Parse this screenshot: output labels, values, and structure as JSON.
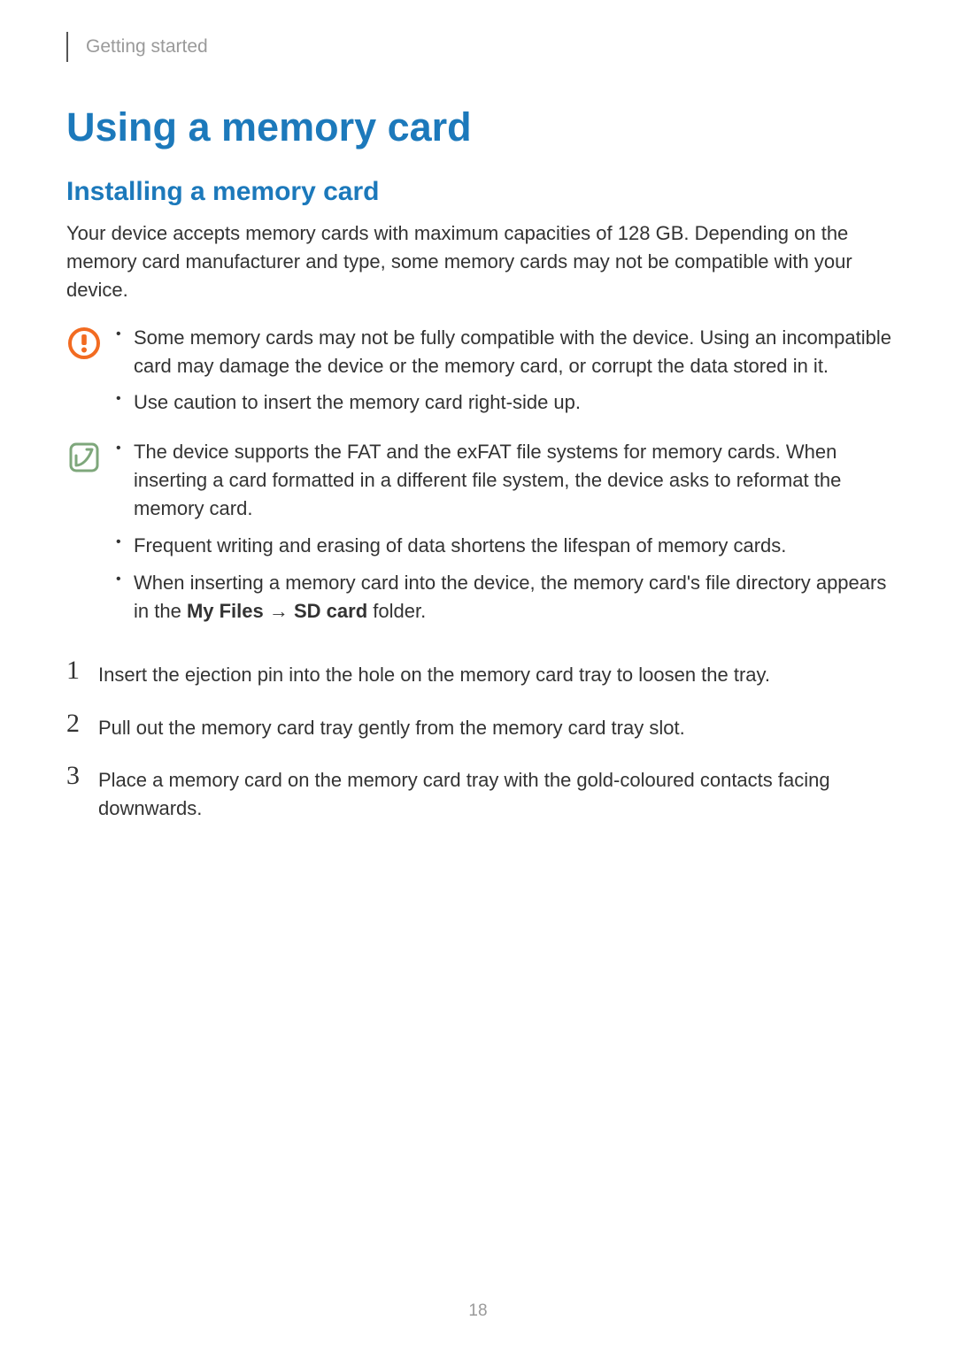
{
  "header": {
    "section": "Getting started"
  },
  "title": "Using a memory card",
  "subtitle": "Installing a memory card",
  "intro": "Your device accepts memory cards with maximum capacities of 128 GB. Depending on the memory card manufacturer and type, some memory cards may not be compatible with your device.",
  "warning": {
    "bullets": [
      "Some memory cards may not be fully compatible with the device. Using an incompatible card may damage the device or the memory card, or corrupt the data stored in it.",
      "Use caution to insert the memory card right-side up."
    ]
  },
  "note": {
    "bullets": [
      "The device supports the FAT and the exFAT file systems for memory cards. When inserting a card formatted in a different file system, the device asks to reformat the memory card.",
      "Frequent writing and erasing of data shortens the lifespan of memory cards."
    ],
    "bullet3": {
      "pre": "When inserting a memory card into the device, the memory card's file directory appears in the ",
      "bold1": "My Files",
      "arrow": " → ",
      "bold2": "SD card",
      "post": " folder."
    }
  },
  "steps": {
    "s1": {
      "num": "1",
      "text": "Insert the ejection pin into the hole on the memory card tray to loosen the tray."
    },
    "s2": {
      "num": "2",
      "text": "Pull out the memory card tray gently from the memory card tray slot."
    },
    "s3": {
      "num": "3",
      "text": "Place a memory card on the memory card tray with the gold-coloured contacts facing downwards."
    }
  },
  "page_number": "18"
}
